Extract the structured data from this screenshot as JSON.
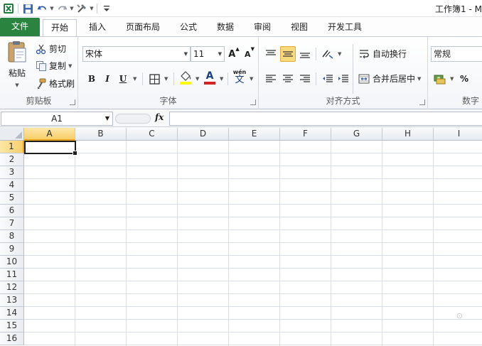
{
  "title": "工作簿1 - M",
  "colors": {
    "file_tab": "#2a8440",
    "selected_header": "#f8cf6a",
    "toggle_active": "#fbd97c",
    "font_color_bar": "#d62020",
    "fill_color_bar": "#ffff00"
  },
  "quick_access": {
    "icons": [
      "excel-logo-icon",
      "save-icon",
      "undo-icon",
      "redo-icon",
      "tools-icon",
      "customize-dropdown-icon"
    ]
  },
  "tabs": [
    {
      "label": "文件"
    },
    {
      "label": "开始"
    },
    {
      "label": "插入"
    },
    {
      "label": "页面布局"
    },
    {
      "label": "公式"
    },
    {
      "label": "数据"
    },
    {
      "label": "审阅"
    },
    {
      "label": "视图"
    },
    {
      "label": "开发工具"
    }
  ],
  "clipboard": {
    "label": "剪贴板",
    "paste": "粘贴",
    "cut": "剪切",
    "copy": "复制",
    "format_painter": "格式刷"
  },
  "font": {
    "label": "字体",
    "name": "宋体",
    "size": "11",
    "bold": "B",
    "italic": "I",
    "underline": "U",
    "grow": "A",
    "shrink": "A",
    "color_a": "A",
    "phonetic": "wén"
  },
  "alignment": {
    "label": "对齐方式",
    "wrap_text": "自动换行",
    "merge_center": "合并后居中",
    "active_vertical": "middle"
  },
  "number": {
    "label": "数字",
    "format": "常规",
    "percent": "%"
  },
  "formula_bar": {
    "name_box": "A1",
    "fx": "fx",
    "content": ""
  },
  "sheet": {
    "columns": [
      "A",
      "B",
      "C",
      "D",
      "E",
      "F",
      "G",
      "H",
      "I"
    ],
    "rows": [
      "1",
      "2",
      "3",
      "4",
      "5",
      "6",
      "7",
      "8",
      "9",
      "10",
      "11",
      "12",
      "13",
      "14",
      "15",
      "16"
    ],
    "active_column": "A",
    "active_row": "1"
  }
}
